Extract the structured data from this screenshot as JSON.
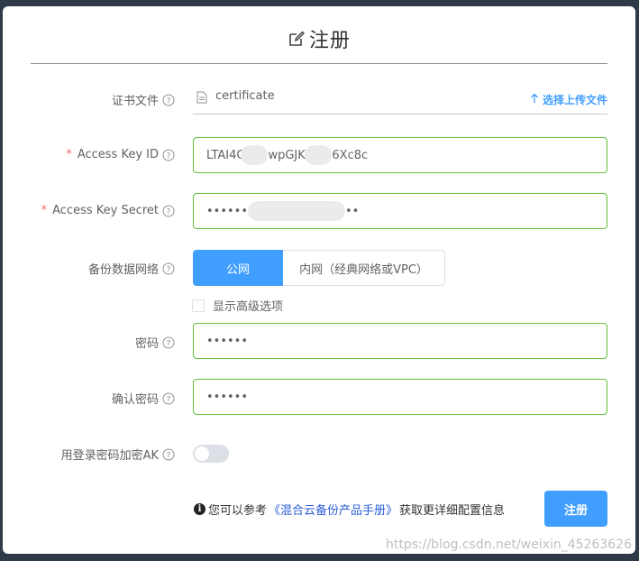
{
  "dialog": {
    "title": "注册",
    "title_icon": "edit-icon"
  },
  "form": {
    "certificate": {
      "label": "证书文件",
      "file_name": "certificate",
      "upload_label": "选择上传文件"
    },
    "access_key_id": {
      "label": "Access Key ID",
      "value_parts": [
        "LTAI4C",
        "wpGJKl",
        "6Xc8c"
      ]
    },
    "access_key_secret": {
      "label": "Access Key Secret",
      "value_start": "••••••",
      "value_end": "••"
    },
    "backup_network": {
      "label": "备份数据网络",
      "options": [
        "公网",
        "内网（经典网络或VPC）"
      ],
      "selected": "公网"
    },
    "advanced": {
      "label": "显示高级选项",
      "checked": false
    },
    "password": {
      "label": "密码",
      "value": "••••••"
    },
    "confirm_password": {
      "label": "确认密码",
      "value": "••••••"
    },
    "encrypt_ak": {
      "label": "用登录密码加密AK",
      "enabled": false
    }
  },
  "footer": {
    "info_prefix": "您可以参考",
    "manual_link": "《混合云备份产品手册》",
    "info_suffix": "获取更详细配置信息",
    "submit_label": "注册"
  },
  "watermark": "https://blog.csdn.net/weixin_45263626",
  "colors": {
    "primary": "#409eff",
    "valid_border": "#67c23a",
    "required": "#f56c6c",
    "link": "#2b5fd9"
  }
}
